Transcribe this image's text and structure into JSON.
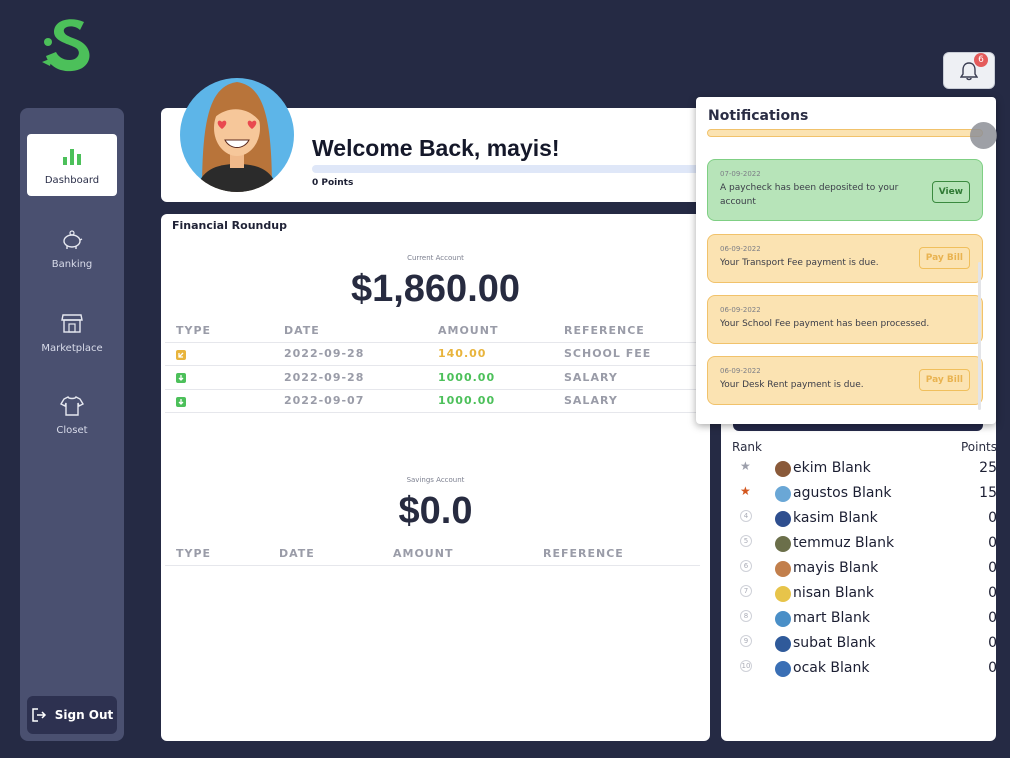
{
  "notifications_badge": "6",
  "sidebar": {
    "items": [
      {
        "label": "Dashboard",
        "icon": "bar-chart-icon",
        "active": true
      },
      {
        "label": "Banking",
        "icon": "piggy-bank-icon",
        "active": false
      },
      {
        "label": "Marketplace",
        "icon": "store-icon",
        "active": false
      },
      {
        "label": "Closet",
        "icon": "shirt-icon",
        "active": false
      }
    ],
    "sign_out": "Sign Out"
  },
  "welcome": {
    "title": "Welcome Back, mayis!",
    "points": "0 Points",
    "progress": 0
  },
  "financial": {
    "title": "Financial Roundup",
    "current": {
      "label": "Current Account",
      "balance": "$1,860.00",
      "headers": [
        "TYPE",
        "DATE",
        "AMOUNT",
        "REFERENCE"
      ],
      "rows": [
        {
          "type": "out",
          "date": "2022-09-28",
          "amount": "140.00",
          "reference": "SCHOOL FEE"
        },
        {
          "type": "in",
          "date": "2022-09-28",
          "amount": "1000.00",
          "reference": "SALARY"
        },
        {
          "type": "in",
          "date": "2022-09-07",
          "amount": "1000.00",
          "reference": "SALARY"
        }
      ]
    },
    "savings": {
      "label": "Savings Account",
      "balance": "$0.0",
      "headers": [
        "TYPE",
        "DATE",
        "AMOUNT",
        "REFERENCE"
      ]
    }
  },
  "leaderboard": {
    "rank_header": "Rank",
    "points_header": "Points",
    "rows": [
      {
        "rank": "1",
        "name": "ekim Blank",
        "points": "25"
      },
      {
        "rank": "2",
        "name": "agustos Blank",
        "points": "15"
      },
      {
        "rank": "4",
        "name": "kasim Blank",
        "points": "0"
      },
      {
        "rank": "5",
        "name": "temmuz Blank",
        "points": "0"
      },
      {
        "rank": "6",
        "name": "mayis Blank",
        "points": "0"
      },
      {
        "rank": "7",
        "name": "nisan Blank",
        "points": "0"
      },
      {
        "rank": "8",
        "name": "mart Blank",
        "points": "0"
      },
      {
        "rank": "9",
        "name": "subat Blank",
        "points": "0"
      },
      {
        "rank": "10",
        "name": "ocak Blank",
        "points": "0"
      }
    ]
  },
  "notifications": {
    "title": "Notifications",
    "items": [
      {
        "date": "07-09-2022",
        "text": "A paycheck has been deposited to your account",
        "kind": "green",
        "button": "View"
      },
      {
        "date": "06-09-2022",
        "text": "Your Transport Fee payment is due.",
        "kind": "yellow",
        "button": "Pay Bill"
      },
      {
        "date": "06-09-2022",
        "text": "Your School Fee payment has been processed.",
        "kind": "yellow",
        "button": ""
      },
      {
        "date": "06-09-2022",
        "text": "Your Desk Rent payment is due.",
        "kind": "yellow",
        "button": "Pay Bill"
      }
    ]
  },
  "colors": {
    "background": "#252a44",
    "sidebar": "#4a5070",
    "income": "#4cc05a",
    "expense": "#e8b43c",
    "brand": "#4cc05a"
  }
}
